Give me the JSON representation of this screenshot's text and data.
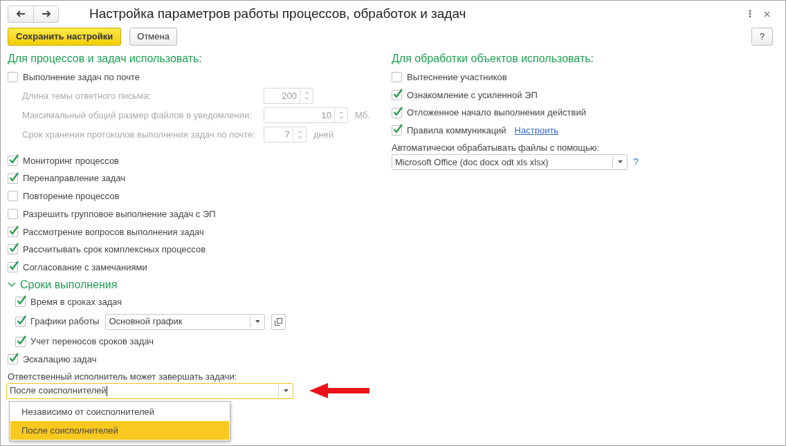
{
  "window": {
    "title": "Настройка параметров работы процессов, обработок и задач"
  },
  "toolbar": {
    "buttons": [
      {
        "label": "Сохранить настройки",
        "kind": "primary"
      },
      {
        "label": "Отмена",
        "kind": "default"
      }
    ],
    "help": "?"
  },
  "left": {
    "heading": "Для процессов и задач использовать:",
    "items": [
      {
        "kind": "checkbox",
        "label": "Выполнение задач по почте",
        "checked": false
      },
      {
        "kind": "number",
        "label": "Длина темы ответного письма:",
        "value": "200",
        "disabled": true
      },
      {
        "kind": "number",
        "label": "Максимальный общий размер файлов в уведомлении:",
        "value": "10",
        "unit": "Мб.",
        "disabled": true
      },
      {
        "kind": "number",
        "label": "Срок хранения протоколов выполнения задач по почте:",
        "value": "7",
        "unit": "дней",
        "disabled": true
      },
      {
        "kind": "checkbox",
        "label": "Мониторинг процессов",
        "checked": true
      },
      {
        "kind": "checkbox",
        "label": "Перенаправление задач",
        "checked": true
      },
      {
        "kind": "checkbox",
        "label": "Повторение процессов",
        "checked": false
      },
      {
        "kind": "checkbox",
        "label": "Разрешить групповое выполнение задач с ЭП",
        "checked": false
      },
      {
        "kind": "checkbox",
        "label": "Рассмотрение вопросов выполнения задач",
        "checked": true
      },
      {
        "kind": "checkbox",
        "label": "Рассчитывать срок комплексных процессов",
        "checked": true
      },
      {
        "kind": "checkbox",
        "label": "Согласование с замечаниями",
        "checked": true
      },
      {
        "kind": "group",
        "label": "Сроки выполнения",
        "expanded": true,
        "children": [
          {
            "kind": "checkbox",
            "label": "Время в сроках задач",
            "checked": true
          },
          {
            "kind": "checkbox_select",
            "label": "Графики работы",
            "checked": true,
            "value": "Основной график"
          },
          {
            "kind": "checkbox",
            "label": "Учет переносов сроков задач",
            "checked": true
          }
        ]
      },
      {
        "kind": "checkbox",
        "label": "Эскалацию задач",
        "checked": true
      },
      {
        "kind": "dropdown",
        "label": "Ответственный исполнитель может завершать задачи:",
        "value": "После соисполнителей",
        "focused": true,
        "options": [
          {
            "label": "Независимо от соисполнителей",
            "selected": false
          },
          {
            "label": "После соисполнителей",
            "selected": true
          }
        ]
      }
    ]
  },
  "right": {
    "heading": "Для обработки объектов использовать:",
    "items": [
      {
        "kind": "checkbox",
        "label": "Вытеснение участников",
        "checked": false
      },
      {
        "kind": "checkbox",
        "label": "Ознакомление с усиленной ЭП",
        "checked": true
      },
      {
        "kind": "checkbox",
        "label": "Отложенное начало выполнения действий",
        "checked": true
      },
      {
        "kind": "checkbox",
        "label": "Правила коммуникаций",
        "checked": true,
        "link": "Настроить"
      },
      {
        "kind": "dropdown",
        "label": "Автоматически обрабатывать файлы с помощью:",
        "value": "Microsoft Office (doc docx odt xls xlsx)",
        "help": "?"
      }
    ]
  }
}
